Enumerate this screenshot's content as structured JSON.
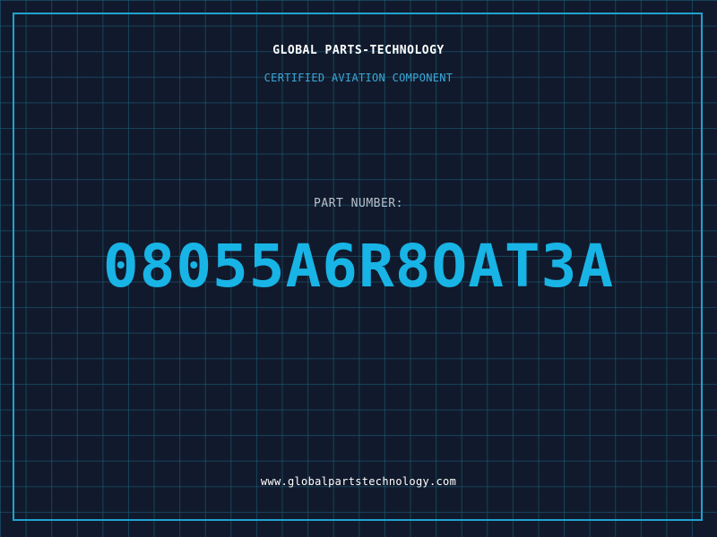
{
  "header": {
    "brand": "GLOBAL PARTS-TECHNOLOGY",
    "subtitle": "CERTIFIED AVIATION COMPONENT"
  },
  "part": {
    "label": "PART NUMBER:",
    "number": "08055A6R8OAT3A"
  },
  "footer": {
    "website": "www.globalpartstechnology.com"
  },
  "colors": {
    "background": "#111a2c",
    "grid": "#1a6480",
    "frame": "#1fa3d0",
    "accent": "#18b4e6",
    "subtitle": "#3aa8d8",
    "label": "#b8c0cc",
    "text": "#ffffff"
  }
}
